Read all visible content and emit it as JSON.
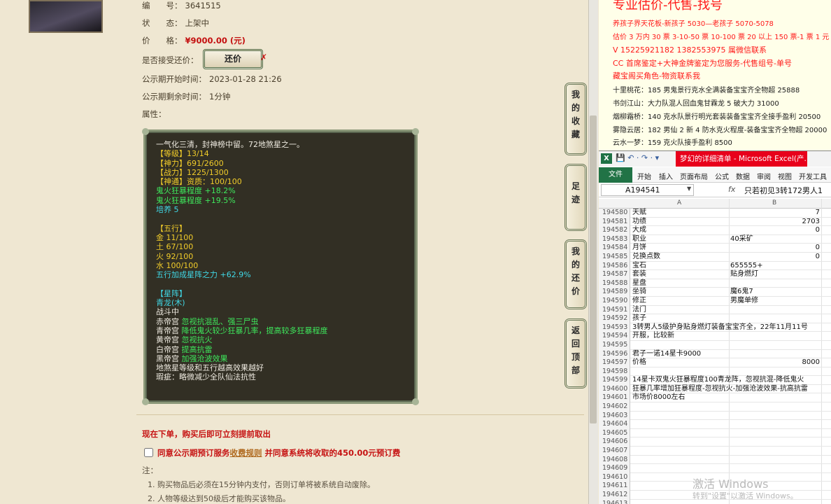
{
  "listing": {
    "id_key": "编　　号：",
    "id_val": "3641515",
    "status_key": "状　　态：",
    "status_val": "上架中",
    "price_key": "价　　格：",
    "price_val": "¥9000.00 (元)",
    "bargain_key": "是否接受还价：",
    "bargain_btn": "还价",
    "bargain_x": "✗",
    "pub_start_key": "公示期开始时间：",
    "pub_start_val": "2023-01-28 21:26",
    "pub_left_key": "公示期剩余时间：",
    "pub_left_val": "1分钟",
    "attr_key": "属性："
  },
  "attributes": [
    {
      "t": "一气化三清，封神榜中留。72地煞星之一。",
      "c": "w"
    },
    {
      "t": "【等级】13/14",
      "c": "y"
    },
    {
      "t": "【神力】691/2600",
      "c": "y"
    },
    {
      "t": "【战力】1225/1300",
      "c": "y"
    },
    {
      "t": "【神通】资质：100/100",
      "c": "y"
    },
    {
      "t": "鬼火狂暴程度 +18.2%",
      "c": "g"
    },
    {
      "t": "鬼火狂暴程度 +19.5%",
      "c": "g"
    },
    {
      "t": "培养 5",
      "c": "c"
    },
    {
      "t": "",
      "c": "w"
    },
    {
      "t": "【五行】",
      "c": "y"
    },
    {
      "t": "金 11/100",
      "c": "y"
    },
    {
      "t": "土 67/100",
      "c": "y"
    },
    {
      "t": "火 92/100",
      "c": "y"
    },
    {
      "t": "水 100/100",
      "c": "y"
    },
    {
      "t": "五行加成星阵之力 +62.9%",
      "c": "c"
    },
    {
      "t": "",
      "c": "w"
    },
    {
      "t": "【星阵】",
      "c": "c"
    },
    {
      "t": "青龙(木)",
      "c": "c"
    },
    {
      "t": "战斗中",
      "c": "w"
    },
    {
      "t": "赤帝宫 忽视抗混乱、强三尸虫",
      "c": "gw",
      "p": "赤帝宫 ",
      "s": "忽视抗混乱、强三尸虫"
    },
    {
      "t": "青帝宫 降低鬼火较少狂暴几率，提高较多狂暴程度",
      "c": "gw",
      "p": "青帝宫 ",
      "s": "降低鬼火较少狂暴几率，提高较多狂暴程度"
    },
    {
      "t": "黄帝宫 忽视抗火",
      "c": "gw",
      "p": "黄帝宫 ",
      "s": "忽视抗火"
    },
    {
      "t": "白帝宫 提高抗雷",
      "c": "gw",
      "p": "白帝宫 ",
      "s": "提高抗雷"
    },
    {
      "t": "黑帝宫 加强沧波效果",
      "c": "gw",
      "p": "黑帝宫 ",
      "s": "加强沧波效果"
    },
    {
      "t": "地煞星等级和五行越高效果越好",
      "c": "w"
    },
    {
      "t": "瑕疵：略微减少全队仙法抗性",
      "c": "w"
    }
  ],
  "order": {
    "now_order": "现在下单，购买后即可立刻提前取出",
    "agree_prefix": "同意公示期预订服务",
    "rule_link": "收费规则",
    "agree_suffix": " 并同意系统将收取的450.00元预订费",
    "note_title": "注：",
    "notes": [
      "1. 购买物品后必须在15分钟内支付，否则订单将被系统自动废除。",
      "2. 人物等级达到50级后才能购买该物品。"
    ]
  },
  "side_tabs": [
    "我的收藏",
    "足迹",
    "我的还价",
    "返回顶部"
  ],
  "doc": {
    "title": "专业估价-代售-找号",
    "lines": [
      {
        "t": "养孩子界天花板-新孩子 5030—老孩子 5070-5078",
        "red": true
      },
      {
        "t": "估价 3 万内 30 票 3-10-50 票 10-100 票 20 以上 150 票-1 票 1 元",
        "red": true
      },
      {
        "t": "V 15225921182    1382553975    属微信联系",
        "red": true,
        "big": true
      },
      {
        "t": "CC 首席鉴定+大神金牌鉴定为您服务-代售组号-单号",
        "red": true,
        "big": true
      },
      {
        "t": "藏宝阁买角色-物资联系我",
        "red": true,
        "big": true
      },
      {
        "t": "十里桃花：185 男鬼景行克水全满装备宝宝齐全物超 25888",
        "red": false
      },
      {
        "t": "书剑江山：大力队混人回血鬼甘霖龙 5 破大力 31000",
        "red": false
      },
      {
        "t": "烟柳霜桥：140 克水队景行明光套装装备宝宝齐全接手盈利 20500",
        "red": false
      },
      {
        "t": "雾隐云居：182 男仙 2 新 4 防水克火程度-装备宝宝齐全物超 20000",
        "red": false
      },
      {
        "t": "云水一梦：159 克火队接手盈利 8500",
        "red": false
      }
    ]
  },
  "excel": {
    "logo": "X",
    "qat": "💾 ↶ · ↷ · ▾",
    "caption": "梦幻的详细清单 - Microsoft Excel(产...",
    "tabs": [
      "文件",
      "开始",
      "插入",
      "页面布局",
      "公式",
      "数据",
      "审阅",
      "视图",
      "开发工具"
    ],
    "cell_ref": "A194541",
    "fx": "fx",
    "formula": "只若初见3转172男人1",
    "col_a": "A",
    "col_b": "B",
    "rows": [
      {
        "n": "194580",
        "a": "天赋",
        "b": "",
        "bn": "7"
      },
      {
        "n": "194581",
        "a": "功绩",
        "b": "",
        "bn": "2703"
      },
      {
        "n": "194582",
        "a": "大成",
        "b": "",
        "bn": "0"
      },
      {
        "n": "194583",
        "a": "职业",
        "b": "40采矿",
        "bn": ""
      },
      {
        "n": "194584",
        "a": "月饼",
        "b": "",
        "bn": "0"
      },
      {
        "n": "194585",
        "a": "兑换点数",
        "b": "",
        "bn": "0"
      },
      {
        "n": "194586",
        "a": "宝石",
        "b": "655555+",
        "bn": ""
      },
      {
        "n": "194587",
        "a": "套装",
        "b": "贴身燃灯",
        "bn": ""
      },
      {
        "n": "194588",
        "a": "星盘",
        "b": "",
        "bn": ""
      },
      {
        "n": "194589",
        "a": "坐骑",
        "b": "魔6鬼7",
        "bn": ""
      },
      {
        "n": "194590",
        "a": "修正",
        "b": "男魔单修",
        "bn": ""
      },
      {
        "n": "194591",
        "a": "法门",
        "b": "",
        "bn": ""
      },
      {
        "n": "194592",
        "a": "孩子",
        "b": "",
        "bn": ""
      },
      {
        "n": "194593",
        "a": "3转男人5级护身贴身燃灯装备宝宝齐全，22年11月11号",
        "b": "",
        "bn": ""
      },
      {
        "n": "194594",
        "a": "开服，比较新",
        "b": "",
        "bn": ""
      },
      {
        "n": "194595",
        "a": "",
        "b": "",
        "bn": ""
      },
      {
        "n": "194596",
        "a": "君子一诺14星卡9000",
        "b": "",
        "bn": ""
      },
      {
        "n": "194597",
        "a": "价格",
        "b": "",
        "bn": "8000"
      },
      {
        "n": "194598",
        "a": "",
        "b": "",
        "bn": ""
      },
      {
        "n": "194599",
        "a": "14星卡双鬼火狂暴程度100青龙阵，忽视抗混-降低鬼火",
        "b": "",
        "bn": ""
      },
      {
        "n": "194600",
        "a": "狂暴几率增加狂暴程度-忽视抗火-加强沧波效果-抗高抗雷",
        "b": "",
        "bn": ""
      },
      {
        "n": "194601",
        "a": "市场价8000左右",
        "b": "",
        "bn": ""
      },
      {
        "n": "194602",
        "a": "",
        "b": "",
        "bn": ""
      },
      {
        "n": "194603",
        "a": "",
        "b": "",
        "bn": ""
      },
      {
        "n": "194604",
        "a": "",
        "b": "",
        "bn": ""
      },
      {
        "n": "194605",
        "a": "",
        "b": "",
        "bn": ""
      },
      {
        "n": "194606",
        "a": "",
        "b": "",
        "bn": ""
      },
      {
        "n": "194607",
        "a": "",
        "b": "",
        "bn": ""
      },
      {
        "n": "194608",
        "a": "",
        "b": "",
        "bn": ""
      },
      {
        "n": "194609",
        "a": "",
        "b": "",
        "bn": ""
      },
      {
        "n": "194610",
        "a": "",
        "b": "",
        "bn": ""
      },
      {
        "n": "194611",
        "a": "",
        "b": "",
        "bn": ""
      },
      {
        "n": "194612",
        "a": "",
        "b": "",
        "bn": ""
      },
      {
        "n": "194613",
        "a": "",
        "b": "",
        "bn": ""
      }
    ]
  },
  "windows_activation": {
    "line1": "激活 Windows",
    "line2": "转到\"设置\"以激活 Windows。"
  }
}
